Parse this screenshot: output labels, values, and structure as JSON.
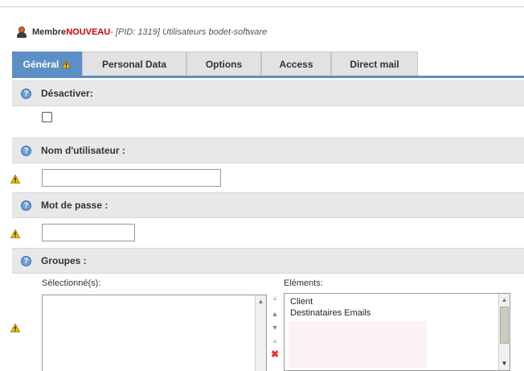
{
  "header": {
    "prefix": "Membre ",
    "new_label": "NOUVEAU",
    "context": " - [PID: 1319] Utilisateurs bodet-software"
  },
  "tabs": [
    {
      "label": "Général",
      "active": true,
      "warning": true
    },
    {
      "label": "Personal Data"
    },
    {
      "label": "Options"
    },
    {
      "label": "Access"
    },
    {
      "label": "Direct mail"
    }
  ],
  "sections": {
    "disable": {
      "label": "Désactiver:",
      "checked": false
    },
    "username": {
      "label": "Nom d'utilisateur :",
      "value": ""
    },
    "password": {
      "label": "Mot de passe :",
      "value": ""
    },
    "groups": {
      "label": "Groupes :",
      "selected_label": "Sélectionné(s):",
      "elements_label": "Eléments:",
      "elements": [
        "Client",
        "Destinataires Emails"
      ]
    }
  },
  "icons": {
    "help": "help-icon",
    "warning": "warning-icon",
    "user": "user-icon",
    "delete": "delete-icon"
  },
  "colors": {
    "tab_active": "#5d8fc7",
    "new_label": "#cc0000",
    "warning": "#f2c200",
    "delete": "#e0312a"
  }
}
